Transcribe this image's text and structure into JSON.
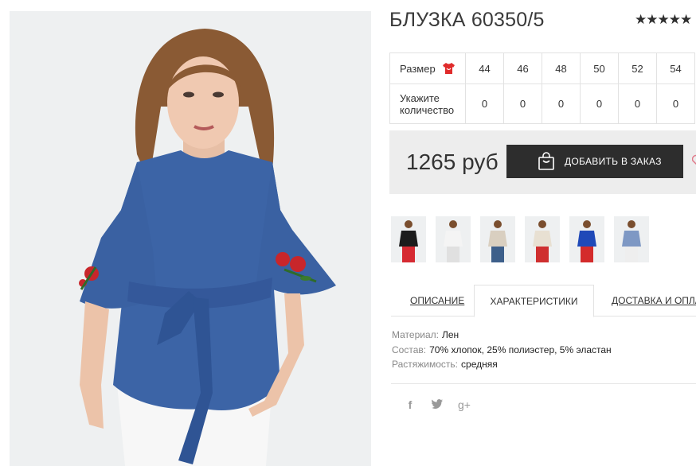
{
  "product": {
    "title": "БЛУЗКА 60350/5",
    "rating_stars": "★★★★★"
  },
  "size_table": {
    "size_label": "Размер",
    "qty_label_line1": "Укажите",
    "qty_label_line2": "количество",
    "sizes": [
      "44",
      "46",
      "48",
      "50",
      "52",
      "54"
    ],
    "quantities": [
      "0",
      "0",
      "0",
      "0",
      "0",
      "0"
    ]
  },
  "buy": {
    "price": "1265 руб",
    "add_to_order_label": "ДОБАВИТЬ В ЗАКАЗ"
  },
  "thumbnails": [
    {
      "name": "black-variant",
      "top": "#1c1c1c",
      "bottom": "#d62a32"
    },
    {
      "name": "white-variant",
      "top": "#f4f4f4",
      "bottom": "#e0e0e0"
    },
    {
      "name": "beige-variant",
      "top": "#d9cfc0",
      "bottom": "#3d5f8a"
    },
    {
      "name": "cream-variant",
      "top": "#e8e0d2",
      "bottom": "#cf2f2f"
    },
    {
      "name": "royal-blue-variant",
      "top": "#1f49b8",
      "bottom": "#d42b2b"
    },
    {
      "name": "denim-variant",
      "top": "#7e98c4",
      "bottom": "#eeeeee"
    }
  ],
  "tabs": [
    {
      "label": "Описание",
      "active": false
    },
    {
      "label": "Характеристики",
      "active": true
    },
    {
      "label": "Доставка и оплата",
      "active": false
    }
  ],
  "characteristics": [
    {
      "key": "Материал:",
      "value": "Лен"
    },
    {
      "key": "Состав:",
      "value": "70% хлопок, 25% полиэстер, 5% эластан"
    },
    {
      "key": "Растяжимость:",
      "value": "средняя"
    }
  ],
  "social": {
    "facebook": "f",
    "twitter": "🐦",
    "google_plus": "g+"
  },
  "colors": {
    "button_bg": "#2d2d2d",
    "buybox_bg": "#ededed",
    "icon_red": "#e02b2b",
    "blouse_blue": "#3c64a6"
  }
}
